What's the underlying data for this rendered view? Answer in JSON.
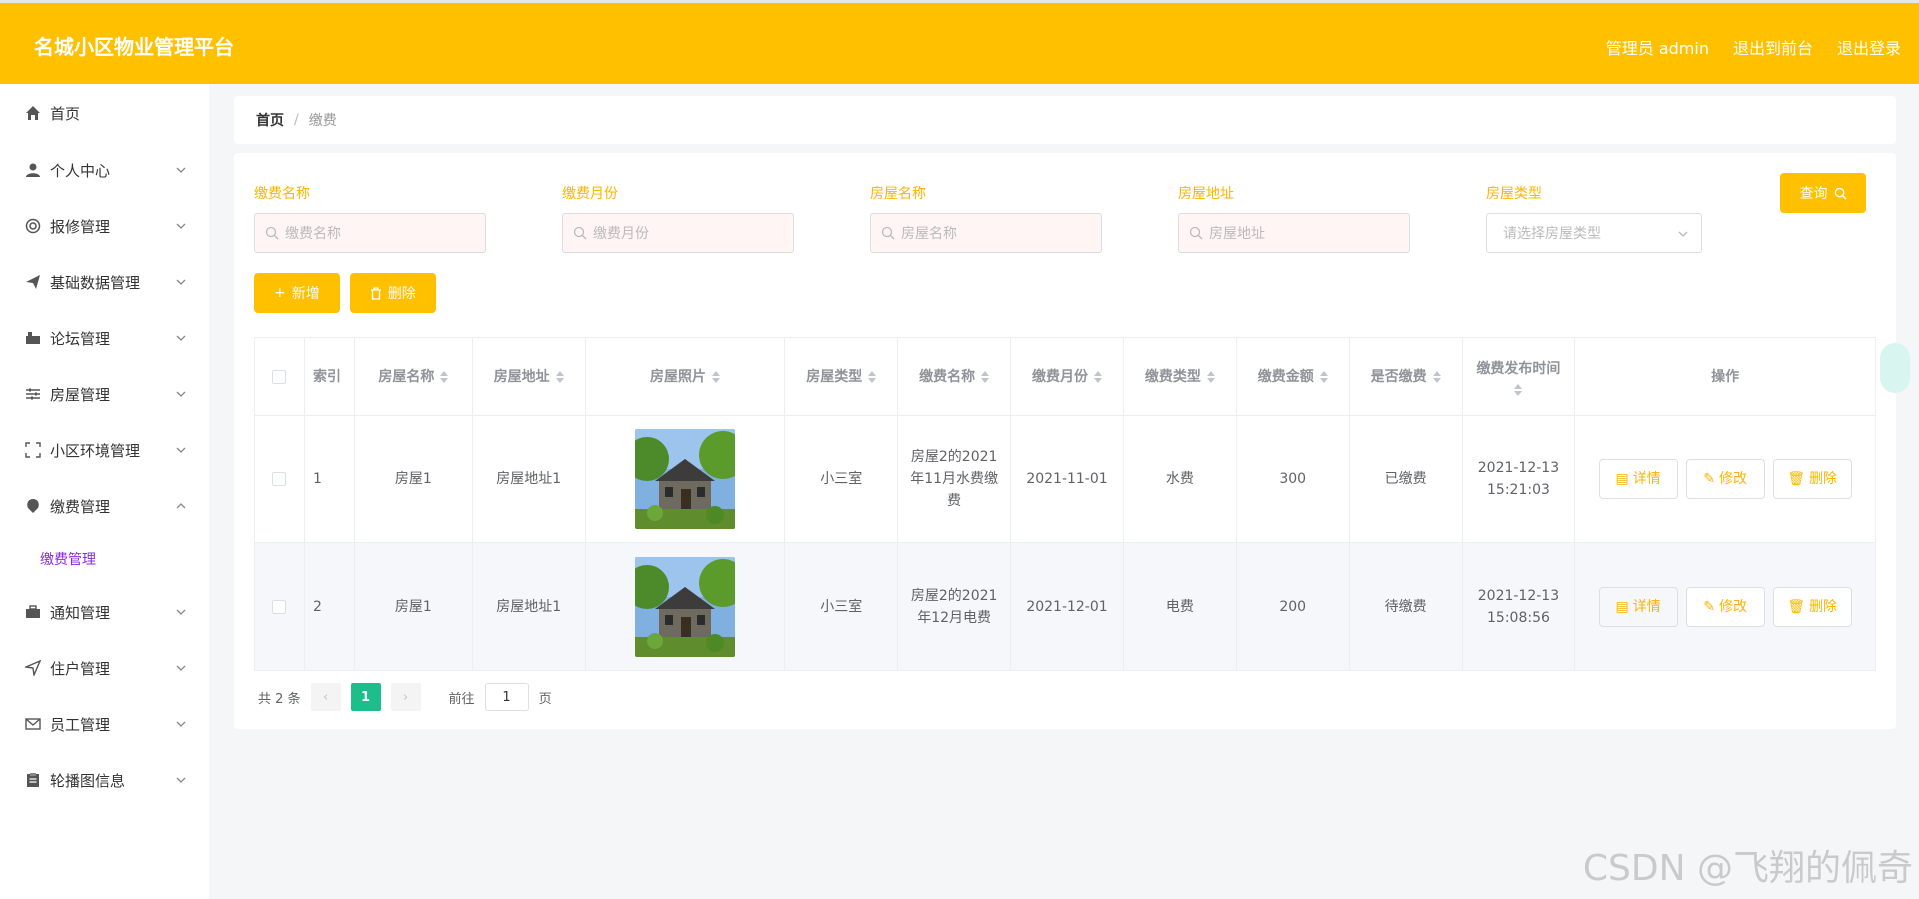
{
  "header": {
    "title": "名城小区物业管理平台",
    "nav": [
      "管理员 admin",
      "退出到前台",
      "退出登录"
    ]
  },
  "sidebar": {
    "items": [
      {
        "label": "首页",
        "icon": "home-icon"
      },
      {
        "label": "个人中心",
        "icon": "user-icon"
      },
      {
        "label": "报修管理",
        "icon": "settings-icon"
      },
      {
        "label": "基础数据管理",
        "icon": "send-icon"
      },
      {
        "label": "论坛管理",
        "icon": "forum-icon"
      },
      {
        "label": "房屋管理",
        "icon": "sliders-icon"
      },
      {
        "label": "小区环境管理",
        "icon": "frame-icon"
      },
      {
        "label": "缴费管理",
        "icon": "payment-icon"
      },
      {
        "label": "通知管理",
        "icon": "briefcase-icon"
      },
      {
        "label": "住户管理",
        "icon": "navigation-icon"
      },
      {
        "label": "员工管理",
        "icon": "mail-icon"
      },
      {
        "label": "轮播图信息",
        "icon": "clipboard-icon"
      }
    ],
    "submenu_label": "缴费管理"
  },
  "breadcrumb": {
    "home": "首页",
    "sep": "/",
    "current": "缴费"
  },
  "filters": [
    {
      "label": "缴费名称",
      "placeholder": "缴费名称"
    },
    {
      "label": "缴费月份",
      "placeholder": "缴费月份"
    },
    {
      "label": "房屋名称",
      "placeholder": "房屋名称"
    },
    {
      "label": "房屋地址",
      "placeholder": "房屋地址"
    },
    {
      "label": "房屋类型",
      "placeholder": "请选择房屋类型"
    }
  ],
  "query_label": "查询",
  "actions": {
    "add": "新增",
    "delete": "删除"
  },
  "table": {
    "headers": [
      "索引",
      "房屋名称",
      "房屋地址",
      "房屋照片",
      "房屋类型",
      "缴费名称",
      "缴费月份",
      "缴费类型",
      "缴费金额",
      "是否缴费",
      "缴费发布时间",
      "操作"
    ],
    "rows": [
      {
        "index": "1",
        "name": "房屋1",
        "address": "房屋地址1",
        "type": "小三室",
        "fee_name": "房屋2的2021年11月水费缴费",
        "month": "2021-11-01",
        "fee_type": "水费",
        "amount": "300",
        "paid": "已缴费",
        "time": "2021-12-13 15:21:03"
      },
      {
        "index": "2",
        "name": "房屋1",
        "address": "房屋地址1",
        "type": "小三室",
        "fee_name": "房屋2的2021年12月电费",
        "month": "2021-12-01",
        "fee_type": "电费",
        "amount": "200",
        "paid": "待缴费",
        "time": "2021-12-13 15:08:56"
      }
    ],
    "ops": {
      "detail": "详情",
      "edit": "修改",
      "delete": "删除"
    }
  },
  "pager": {
    "total": "共 2 条",
    "current": "1",
    "goto": "前往",
    "page_input": "1",
    "page_unit": "页"
  },
  "watermark": "CSDN @飞翔的佩奇"
}
